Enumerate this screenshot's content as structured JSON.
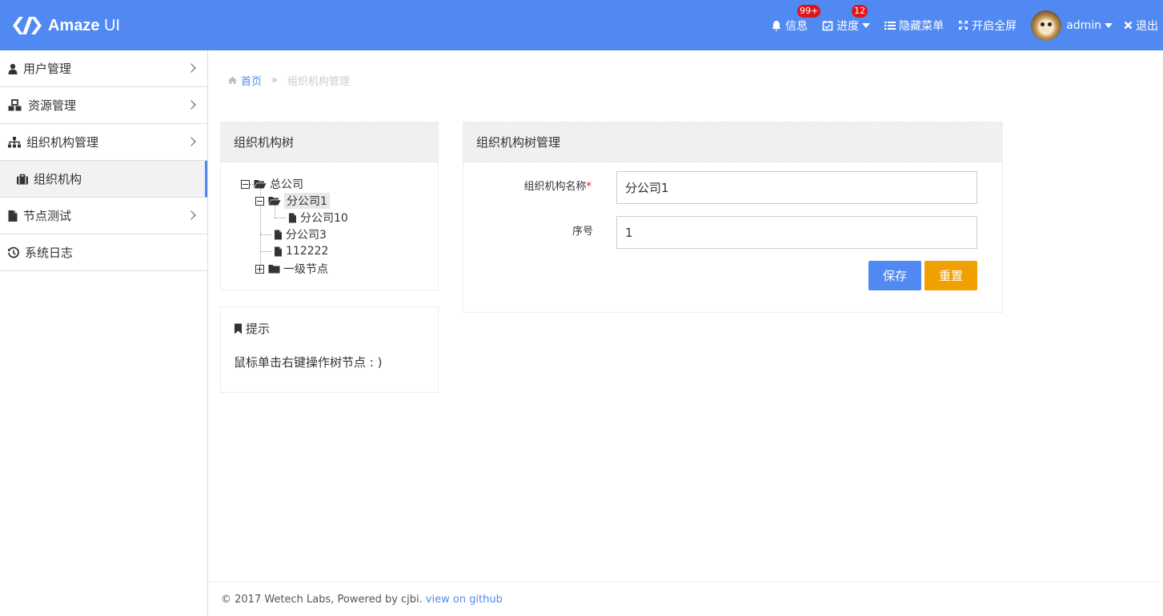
{
  "colors": {
    "header_bg": "#5089f2",
    "accent": "#5089f2",
    "save_btn": "#5089f2",
    "reset_btn": "#f0a000",
    "badge": "#e0161b"
  },
  "header": {
    "logo_bold": "Amaze",
    "logo_thin": "UI",
    "nav": {
      "messages": {
        "label": "信息",
        "badge": "99+",
        "icon": "bell-icon"
      },
      "progress": {
        "label": "进度",
        "badge": "12",
        "icon": "calendar-check-icon"
      },
      "hide_menu": {
        "label": "隐藏菜单",
        "icon": "list-icon"
      },
      "fullscreen": {
        "label": "开启全屏",
        "icon": "expand-icon"
      },
      "user": {
        "label": "admin"
      },
      "logout": {
        "label": "退出",
        "icon": "close-icon"
      }
    }
  },
  "sidebar": {
    "items": [
      {
        "label": "用户管理",
        "icon": "user-icon"
      },
      {
        "label": "资源管理",
        "icon": "cubes-icon"
      },
      {
        "label": "组织机构管理",
        "icon": "sitemap-icon"
      },
      {
        "label": "组织机构",
        "icon": "briefcase-icon"
      },
      {
        "label": "节点测试",
        "icon": "file-icon"
      },
      {
        "label": "系统日志",
        "icon": "history-icon"
      }
    ]
  },
  "breadcrumb": {
    "home": "首页",
    "separator": "»",
    "current": "组织机构管理"
  },
  "tree_panel": {
    "title": "组织机构树",
    "nodes": {
      "root": "总公司",
      "branch1": "分公司1",
      "branch10": "分公司10",
      "branch3": "分公司3",
      "n112222": "112222",
      "level1": "一级节点"
    }
  },
  "tip_panel": {
    "title": "提示",
    "text": "鼠标单击右键操作树节点 : )"
  },
  "form_panel": {
    "title": "组织机构树管理",
    "name_label": "组织机构名称",
    "required_mark": "*",
    "name_value": "分公司1",
    "order_label": "序号",
    "order_value": "1",
    "save_label": "保存",
    "reset_label": "重置"
  },
  "footer": {
    "text": "© 2017 Wetech Labs, Powered by cjbi.",
    "link": "view on github"
  }
}
